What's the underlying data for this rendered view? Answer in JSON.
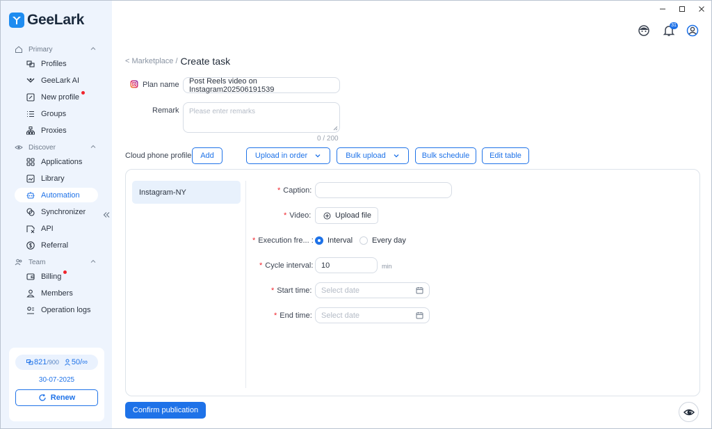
{
  "app": {
    "name": "GeeLark"
  },
  "sidebar": {
    "sections": [
      {
        "label": "Primary"
      },
      {
        "label": "Discover"
      },
      {
        "label": "Team"
      }
    ],
    "items": [
      {
        "label": "Profiles",
        "icon": "profiles-icon"
      },
      {
        "label": "GeeLark AI",
        "icon": "ai-icon"
      },
      {
        "label": "New profile",
        "icon": "new-profile-icon",
        "badge_dot": true
      },
      {
        "label": "Groups",
        "icon": "groups-icon"
      },
      {
        "label": "Proxies",
        "icon": "proxies-icon"
      },
      {
        "label": "Applications",
        "icon": "applications-icon"
      },
      {
        "label": "Library",
        "icon": "library-icon"
      },
      {
        "label": "Automation",
        "icon": "automation-icon",
        "active": true
      },
      {
        "label": "Synchronizer",
        "icon": "synchronizer-icon"
      },
      {
        "label": "API",
        "icon": "api-icon"
      },
      {
        "label": "Referral",
        "icon": "referral-icon"
      },
      {
        "label": "Billing",
        "icon": "billing-icon",
        "badge_dot": true
      },
      {
        "label": "Members",
        "icon": "members-icon"
      },
      {
        "label": "Operation logs",
        "icon": "operation-logs-icon"
      }
    ],
    "quota": {
      "profiles_used": "821",
      "profiles_total": "/900",
      "members_used": "50",
      "members_total": "/∞",
      "expiry_date": "30-07-2025",
      "renew_label": "Renew"
    }
  },
  "header": {
    "notification_count": "31"
  },
  "breadcrumb": {
    "back": "< Marketplace /",
    "current": "Create task"
  },
  "form": {
    "plan_name_label": "Plan name",
    "plan_name_value": "Post Reels video on Instagram202506191539",
    "remark_label": "Remark",
    "remark_placeholder": "Please enter remarks",
    "remark_count": "0 / 200",
    "cloud_phone_label": "Cloud phone profile",
    "add_label": "Add",
    "upload_order_label": "Upload in order",
    "bulk_upload_label": "Bulk upload",
    "bulk_schedule_label": "Bulk schedule",
    "edit_table_label": "Edit table"
  },
  "panel": {
    "profiles": [
      "Instagram-NY"
    ],
    "caption_label": "Caption",
    "video_label": "Video",
    "upload_file_label": "Upload file",
    "exec_freq_label": "Execution fre...",
    "interval_label": "Interval",
    "every_day_label": "Every day",
    "cycle_interval_label": "Cycle interval",
    "cycle_interval_value": "10",
    "cycle_interval_unit": "min",
    "start_time_label": "Start time",
    "end_time_label": "End time",
    "date_placeholder": "Select date",
    "selected_frequency": "Interval"
  },
  "footer": {
    "confirm_label": "Confirm publication"
  },
  "colors": {
    "accent": "#1e72e8",
    "sidebar_bg": "#eef4fd",
    "required": "#f0242c"
  }
}
